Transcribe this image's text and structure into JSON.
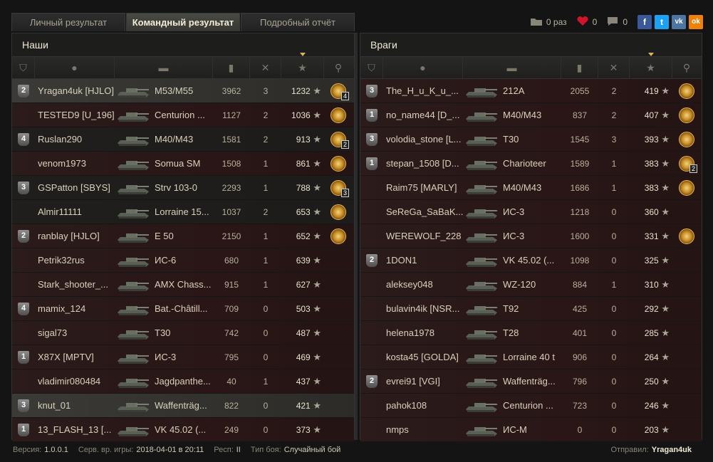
{
  "tabs": [
    {
      "label": "Личный результат",
      "active": false
    },
    {
      "label": "Командный результат",
      "active": true
    },
    {
      "label": "Подробный отчёт",
      "active": false
    }
  ],
  "social": {
    "views": "0 раз",
    "likes": "0",
    "comments": "0",
    "buttons": [
      {
        "name": "facebook",
        "glyph": "f",
        "color": "#3b5998"
      },
      {
        "name": "twitter",
        "glyph": "t",
        "color": "#1da1f2"
      },
      {
        "name": "vk",
        "glyph": "vk",
        "color": "#4c75a3"
      },
      {
        "name": "odnoklassniki",
        "glyph": "ok",
        "color": "#ee8208"
      }
    ]
  },
  "teams": {
    "ours": {
      "title": "Наши",
      "rows": [
        {
          "rank": "2",
          "name": "Yragan4uk [HJLO]",
          "vehicle": "M53/M55",
          "damage": "3962",
          "kills": "3",
          "xp": "1232",
          "medal": true,
          "medal_count": "4",
          "style": "plat"
        },
        {
          "rank": "",
          "name": "TESTED9 [U_196]",
          "vehicle": "Centurion ...",
          "damage": "1127",
          "kills": "2",
          "xp": "1036",
          "medal": true,
          "medal_count": "",
          "style": "even"
        },
        {
          "rank": "4",
          "name": "Ruslan290",
          "vehicle": "M40/M43",
          "damage": "1581",
          "kills": "2",
          "xp": "913",
          "medal": true,
          "medal_count": "2",
          "style": "odd"
        },
        {
          "rank": "",
          "name": "venom1973",
          "vehicle": "Somua SM",
          "damage": "1508",
          "kills": "1",
          "xp": "861",
          "medal": true,
          "medal_count": "",
          "style": "even"
        },
        {
          "rank": "3",
          "name": "GSPatton [SBYS]",
          "vehicle": "Strv 103-0",
          "damage": "2293",
          "kills": "1",
          "xp": "788",
          "medal": true,
          "medal_count": "3",
          "style": "odd"
        },
        {
          "rank": "",
          "name": "Almir11111",
          "vehicle": "Lorraine 15...",
          "damage": "1037",
          "kills": "2",
          "xp": "653",
          "medal": true,
          "medal_count": "",
          "style": "odd"
        },
        {
          "rank": "2",
          "name": "ranblay [HJLO]",
          "vehicle": "E 50",
          "damage": "2150",
          "kills": "1",
          "xp": "652",
          "medal": true,
          "medal_count": "",
          "style": "even"
        },
        {
          "rank": "",
          "name": "Petrik32rus",
          "vehicle": "ИС-6",
          "damage": "680",
          "kills": "1",
          "xp": "639",
          "medal": false,
          "medal_count": "",
          "style": "even"
        },
        {
          "rank": "",
          "name": "Stark_shooter_...",
          "vehicle": "AMX Chass...",
          "damage": "915",
          "kills": "1",
          "xp": "627",
          "medal": false,
          "medal_count": "",
          "style": "even"
        },
        {
          "rank": "4",
          "name": "mamix_124",
          "vehicle": "Bat.-Châtill...",
          "damage": "709",
          "kills": "0",
          "xp": "503",
          "medal": false,
          "medal_count": "",
          "style": "even"
        },
        {
          "rank": "",
          "name": "sigal73",
          "vehicle": "T30",
          "damage": "742",
          "kills": "0",
          "xp": "487",
          "medal": false,
          "medal_count": "",
          "style": "even"
        },
        {
          "rank": "1",
          "name": "X87X [MPTV]",
          "vehicle": "ИС-3",
          "damage": "795",
          "kills": "0",
          "xp": "469",
          "medal": false,
          "medal_count": "",
          "style": "even"
        },
        {
          "rank": "",
          "name": "vladimir080484",
          "vehicle": "Jagdpanthe...",
          "damage": "40",
          "kills": "1",
          "xp": "437",
          "medal": false,
          "medal_count": "",
          "style": "even"
        },
        {
          "rank": "3",
          "name": "knut_01",
          "vehicle": "Waffenträg...",
          "damage": "822",
          "kills": "0",
          "xp": "421",
          "medal": false,
          "medal_count": "",
          "style": "plat"
        },
        {
          "rank": "1",
          "name": "13_FLASH_13 [...",
          "vehicle": "VK 45.02 (...",
          "damage": "249",
          "kills": "0",
          "xp": "373",
          "medal": false,
          "medal_count": "",
          "style": "even"
        }
      ]
    },
    "enemies": {
      "title": "Враги",
      "rows": [
        {
          "rank": "3",
          "name": "The_H_u_K_u_...",
          "vehicle": "212A",
          "damage": "2055",
          "kills": "2",
          "xp": "419",
          "medal": true,
          "medal_count": "",
          "style": "even"
        },
        {
          "rank": "1",
          "name": "no_name44 [D_...",
          "vehicle": "M40/M43",
          "damage": "837",
          "kills": "2",
          "xp": "407",
          "medal": true,
          "medal_count": "",
          "style": "even"
        },
        {
          "rank": "3",
          "name": "volodia_stone [L...",
          "vehicle": "T30",
          "damage": "1545",
          "kills": "3",
          "xp": "393",
          "medal": true,
          "medal_count": "",
          "style": "even"
        },
        {
          "rank": "1",
          "name": "stepan_1508 [D...",
          "vehicle": "Charioteer",
          "damage": "1589",
          "kills": "1",
          "xp": "383",
          "medal": true,
          "medal_count": "2",
          "style": "even"
        },
        {
          "rank": "",
          "name": "Raim75 [MARLY]",
          "vehicle": "M40/M43",
          "damage": "1686",
          "kills": "1",
          "xp": "383",
          "medal": true,
          "medal_count": "",
          "style": "even"
        },
        {
          "rank": "",
          "name": "SeReGa_SaBaK...",
          "vehicle": "ИС-3",
          "damage": "1218",
          "kills": "0",
          "xp": "360",
          "medal": false,
          "medal_count": "",
          "style": "even"
        },
        {
          "rank": "",
          "name": "WEREWOLF_228",
          "vehicle": "ИС-3",
          "damage": "1600",
          "kills": "0",
          "xp": "331",
          "medal": true,
          "medal_count": "",
          "style": "even"
        },
        {
          "rank": "2",
          "name": "1DON1",
          "vehicle": "VK 45.02 (...",
          "damage": "1098",
          "kills": "0",
          "xp": "325",
          "medal": false,
          "medal_count": "",
          "style": "even"
        },
        {
          "rank": "",
          "name": "aleksey048",
          "vehicle": "WZ-120",
          "damage": "884",
          "kills": "1",
          "xp": "310",
          "medal": false,
          "medal_count": "",
          "style": "even"
        },
        {
          "rank": "",
          "name": "bulavin4ik [NSR...",
          "vehicle": "T92",
          "damage": "425",
          "kills": "0",
          "xp": "292",
          "medal": false,
          "medal_count": "",
          "style": "even"
        },
        {
          "rank": "",
          "name": "helena1978",
          "vehicle": "T28",
          "damage": "401",
          "kills": "0",
          "xp": "285",
          "medal": false,
          "medal_count": "",
          "style": "even"
        },
        {
          "rank": "",
          "name": "kosta45 [GOLDA]",
          "vehicle": "Lorraine 40 t",
          "damage": "906",
          "kills": "0",
          "xp": "264",
          "medal": false,
          "medal_count": "",
          "style": "even"
        },
        {
          "rank": "2",
          "name": "evrei91 [VGI]",
          "vehicle": "Waffenträg...",
          "damage": "796",
          "kills": "0",
          "xp": "250",
          "medal": false,
          "medal_count": "",
          "style": "even"
        },
        {
          "rank": "",
          "name": "pahok108",
          "vehicle": "Centurion ...",
          "damage": "723",
          "kills": "0",
          "xp": "246",
          "medal": false,
          "medal_count": "",
          "style": "even"
        },
        {
          "rank": "",
          "name": "nmps",
          "vehicle": "ИС-М",
          "damage": "0",
          "kills": "0",
          "xp": "203",
          "medal": false,
          "medal_count": "",
          "style": "even"
        }
      ]
    }
  },
  "footer": {
    "version_label": "Версия:",
    "version": "1.0.0.1",
    "server_time_label": "Серв. вр. игры:",
    "server_time": "2018-04-01 в 20:11",
    "realm_label": "Респ:",
    "realm": "II",
    "battle_type_label": "Тип боя:",
    "battle_type": "Случайный бой",
    "sender_label": "Отправил:",
    "sender": "Yragan4uk"
  },
  "colors": {
    "accent": "#d9b35a",
    "row_red": "#2b1b1b",
    "row_plat": "#3b3a36"
  }
}
